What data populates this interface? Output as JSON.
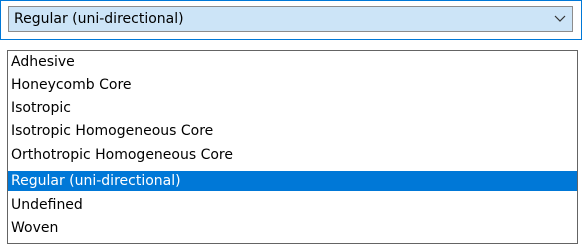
{
  "combo": {
    "selected_value": "Regular (uni-directional)",
    "arrow_icon": "chevron-down-icon"
  },
  "list": {
    "items": [
      {
        "label": "Adhesive",
        "selected": false
      },
      {
        "label": "Honeycomb Core",
        "selected": false
      },
      {
        "label": "Isotropic",
        "selected": false
      },
      {
        "label": "Isotropic Homogeneous Core",
        "selected": false
      },
      {
        "label": "Orthotropic Homogeneous Core",
        "selected": false
      },
      {
        "label": "Regular (uni-directional)",
        "selected": true
      },
      {
        "label": "Undefined",
        "selected": false
      },
      {
        "label": "Woven",
        "selected": false
      }
    ]
  },
  "colors": {
    "accent": "#0078d7",
    "combo_fill": "#cce4f7",
    "selected_text": "#ffffff"
  }
}
